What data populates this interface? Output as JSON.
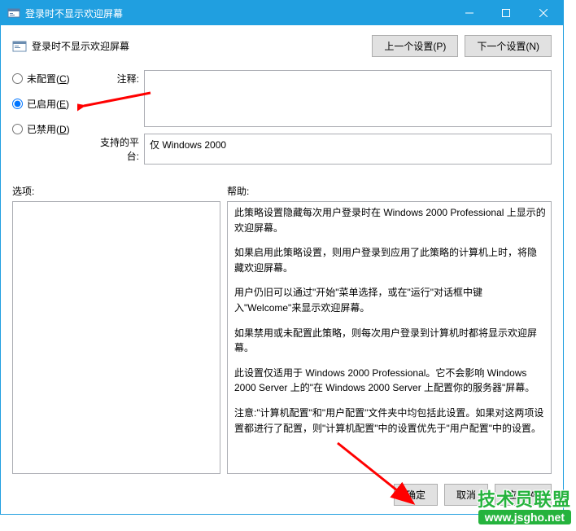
{
  "titlebar": {
    "title": "登录时不显示欢迎屏幕"
  },
  "header": {
    "title": "登录时不显示欢迎屏幕",
    "prev_button": "上一个设置(P)",
    "next_button": "下一个设置(N)"
  },
  "radios": {
    "not_configured": "未配置(C)",
    "enabled": "已启用(E)",
    "disabled": "已禁用(D)"
  },
  "fields": {
    "comment_label": "注释:",
    "comment_value": "",
    "platform_label": "支持的平台:",
    "platform_value": "仅 Windows 2000"
  },
  "pane_labels": {
    "options": "选项:",
    "help": "帮助:"
  },
  "help": {
    "p1": "此策略设置隐藏每次用户登录时在 Windows 2000 Professional 上显示的欢迎屏幕。",
    "p2": "如果启用此策略设置，则用户登录到应用了此策略的计算机上时，将隐藏欢迎屏幕。",
    "p3": "用户仍旧可以通过\"开始\"菜单选择，或在\"运行\"对话框中键入\"Welcome\"来显示欢迎屏幕。",
    "p4": "如果禁用或未配置此策略，则每次用户登录到计算机时都将显示欢迎屏幕。",
    "p5": "此设置仅适用于 Windows 2000 Professional。它不会影响 Windows 2000 Server 上的\"在 Windows 2000 Server 上配置你的服务器\"屏幕。",
    "p6": "注意:\"计算机配置\"和\"用户配置\"文件夹中均包括此设置。如果对这两项设置都进行了配置，则\"计算机配置\"中的设置优先于\"用户配置\"中的设置。"
  },
  "footer": {
    "ok": "确定",
    "cancel": "取消",
    "apply": "应用(A)"
  },
  "watermark": {
    "line1": "技术员联盟",
    "line2": "www.jsgho.net"
  }
}
